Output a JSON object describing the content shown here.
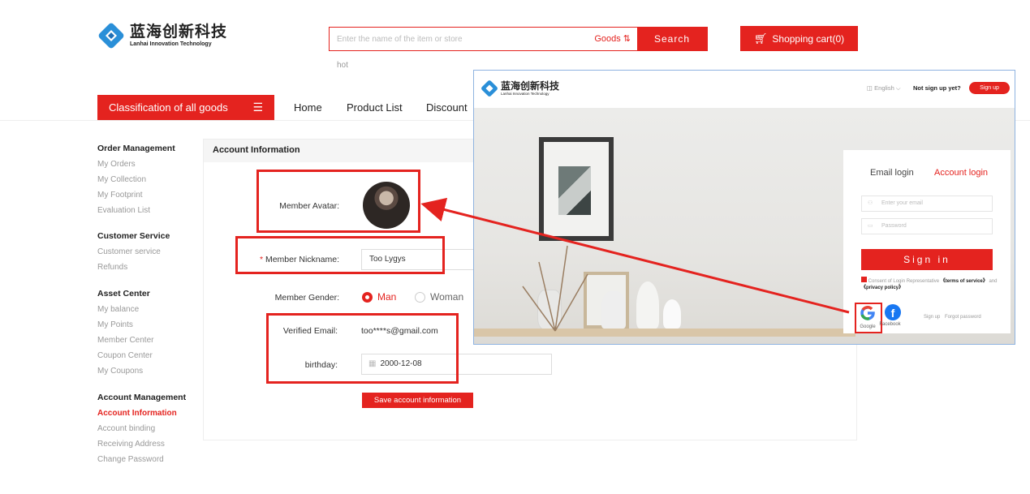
{
  "brand": {
    "name_cn": "蓝海创新科技",
    "name_en": "Lanhai Innovation Technology"
  },
  "search": {
    "placeholder": "Enter the name of the item or store",
    "scope": "Goods ⇅",
    "button": "Search",
    "hot_label": "hot"
  },
  "cart": {
    "label": "Shopping cart(0)"
  },
  "nav": {
    "classify": "Classification of all goods",
    "links": [
      "Home",
      "Product List",
      "Discount"
    ]
  },
  "sidebar": {
    "groups": [
      {
        "title": "Order Management",
        "items": [
          "My Orders",
          "My Collection",
          "My Footprint",
          "Evaluation List"
        ]
      },
      {
        "title": "Customer Service",
        "items": [
          "Customer service",
          "Refunds"
        ]
      },
      {
        "title": "Asset Center",
        "items": [
          "My balance",
          "My Points",
          "Member Center",
          "Coupon Center",
          "My Coupons"
        ]
      },
      {
        "title": "Account Management",
        "items": [
          "Account Information",
          "Account binding",
          "Receiving Address",
          "Change Password"
        ]
      }
    ],
    "active": "Account Information"
  },
  "account": {
    "title": "Account Information",
    "avatar_label": "Member Avatar:",
    "nickname_label": "Member Nickname:",
    "nickname_value": "Too Lygys",
    "gender_label": "Member Gender:",
    "gender_options": [
      "Man",
      "Woman"
    ],
    "gender_selected": "Man",
    "email_label": "Verified Email:",
    "email_value": "too****s@gmail.com",
    "birthday_label": "birthday:",
    "birthday_value": "2000-12-08",
    "save_button": "Save account information"
  },
  "login_popup": {
    "language": "English",
    "not_signed": "Not sign up yet?",
    "signup_button": "Sign up",
    "tabs": [
      "Email login",
      "Account login"
    ],
    "email_placeholder": "Enter your email",
    "password_placeholder": "Password",
    "signin_button": "Sign in",
    "consent_text": "Consent of Login Representative",
    "terms": "《terms of service》",
    "and": "and",
    "privacy": "《privacy policy》",
    "social": [
      "Google",
      "Facebook"
    ],
    "footer_links": [
      "Sign up",
      "Forgot password"
    ]
  },
  "colors": {
    "accent": "#e4231f",
    "popup_border": "#8fb3e0"
  }
}
